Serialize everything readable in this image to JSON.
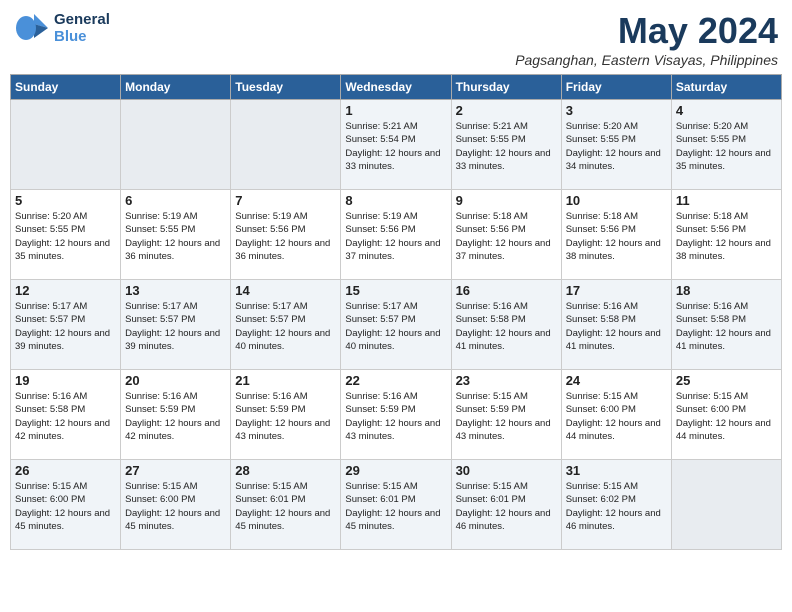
{
  "header": {
    "logo_general": "General",
    "logo_blue": "Blue",
    "month_title": "May 2024",
    "location": "Pagsanghan, Eastern Visayas, Philippines"
  },
  "weekdays": [
    "Sunday",
    "Monday",
    "Tuesday",
    "Wednesday",
    "Thursday",
    "Friday",
    "Saturday"
  ],
  "weeks": [
    [
      {
        "day": "",
        "info": ""
      },
      {
        "day": "",
        "info": ""
      },
      {
        "day": "",
        "info": ""
      },
      {
        "day": "1",
        "info": "Sunrise: 5:21 AM\nSunset: 5:54 PM\nDaylight: 12 hours\nand 33 minutes."
      },
      {
        "day": "2",
        "info": "Sunrise: 5:21 AM\nSunset: 5:55 PM\nDaylight: 12 hours\nand 33 minutes."
      },
      {
        "day": "3",
        "info": "Sunrise: 5:20 AM\nSunset: 5:55 PM\nDaylight: 12 hours\nand 34 minutes."
      },
      {
        "day": "4",
        "info": "Sunrise: 5:20 AM\nSunset: 5:55 PM\nDaylight: 12 hours\nand 35 minutes."
      }
    ],
    [
      {
        "day": "5",
        "info": "Sunrise: 5:20 AM\nSunset: 5:55 PM\nDaylight: 12 hours\nand 35 minutes."
      },
      {
        "day": "6",
        "info": "Sunrise: 5:19 AM\nSunset: 5:55 PM\nDaylight: 12 hours\nand 36 minutes."
      },
      {
        "day": "7",
        "info": "Sunrise: 5:19 AM\nSunset: 5:56 PM\nDaylight: 12 hours\nand 36 minutes."
      },
      {
        "day": "8",
        "info": "Sunrise: 5:19 AM\nSunset: 5:56 PM\nDaylight: 12 hours\nand 37 minutes."
      },
      {
        "day": "9",
        "info": "Sunrise: 5:18 AM\nSunset: 5:56 PM\nDaylight: 12 hours\nand 37 minutes."
      },
      {
        "day": "10",
        "info": "Sunrise: 5:18 AM\nSunset: 5:56 PM\nDaylight: 12 hours\nand 38 minutes."
      },
      {
        "day": "11",
        "info": "Sunrise: 5:18 AM\nSunset: 5:56 PM\nDaylight: 12 hours\nand 38 minutes."
      }
    ],
    [
      {
        "day": "12",
        "info": "Sunrise: 5:17 AM\nSunset: 5:57 PM\nDaylight: 12 hours\nand 39 minutes."
      },
      {
        "day": "13",
        "info": "Sunrise: 5:17 AM\nSunset: 5:57 PM\nDaylight: 12 hours\nand 39 minutes."
      },
      {
        "day": "14",
        "info": "Sunrise: 5:17 AM\nSunset: 5:57 PM\nDaylight: 12 hours\nand 40 minutes."
      },
      {
        "day": "15",
        "info": "Sunrise: 5:17 AM\nSunset: 5:57 PM\nDaylight: 12 hours\nand 40 minutes."
      },
      {
        "day": "16",
        "info": "Sunrise: 5:16 AM\nSunset: 5:58 PM\nDaylight: 12 hours\nand 41 minutes."
      },
      {
        "day": "17",
        "info": "Sunrise: 5:16 AM\nSunset: 5:58 PM\nDaylight: 12 hours\nand 41 minutes."
      },
      {
        "day": "18",
        "info": "Sunrise: 5:16 AM\nSunset: 5:58 PM\nDaylight: 12 hours\nand 41 minutes."
      }
    ],
    [
      {
        "day": "19",
        "info": "Sunrise: 5:16 AM\nSunset: 5:58 PM\nDaylight: 12 hours\nand 42 minutes."
      },
      {
        "day": "20",
        "info": "Sunrise: 5:16 AM\nSunset: 5:59 PM\nDaylight: 12 hours\nand 42 minutes."
      },
      {
        "day": "21",
        "info": "Sunrise: 5:16 AM\nSunset: 5:59 PM\nDaylight: 12 hours\nand 43 minutes."
      },
      {
        "day": "22",
        "info": "Sunrise: 5:16 AM\nSunset: 5:59 PM\nDaylight: 12 hours\nand 43 minutes."
      },
      {
        "day": "23",
        "info": "Sunrise: 5:15 AM\nSunset: 5:59 PM\nDaylight: 12 hours\nand 43 minutes."
      },
      {
        "day": "24",
        "info": "Sunrise: 5:15 AM\nSunset: 6:00 PM\nDaylight: 12 hours\nand 44 minutes."
      },
      {
        "day": "25",
        "info": "Sunrise: 5:15 AM\nSunset: 6:00 PM\nDaylight: 12 hours\nand 44 minutes."
      }
    ],
    [
      {
        "day": "26",
        "info": "Sunrise: 5:15 AM\nSunset: 6:00 PM\nDaylight: 12 hours\nand 45 minutes."
      },
      {
        "day": "27",
        "info": "Sunrise: 5:15 AM\nSunset: 6:00 PM\nDaylight: 12 hours\nand 45 minutes."
      },
      {
        "day": "28",
        "info": "Sunrise: 5:15 AM\nSunset: 6:01 PM\nDaylight: 12 hours\nand 45 minutes."
      },
      {
        "day": "29",
        "info": "Sunrise: 5:15 AM\nSunset: 6:01 PM\nDaylight: 12 hours\nand 45 minutes."
      },
      {
        "day": "30",
        "info": "Sunrise: 5:15 AM\nSunset: 6:01 PM\nDaylight: 12 hours\nand 46 minutes."
      },
      {
        "day": "31",
        "info": "Sunrise: 5:15 AM\nSunset: 6:02 PM\nDaylight: 12 hours\nand 46 minutes."
      },
      {
        "day": "",
        "info": ""
      }
    ]
  ]
}
